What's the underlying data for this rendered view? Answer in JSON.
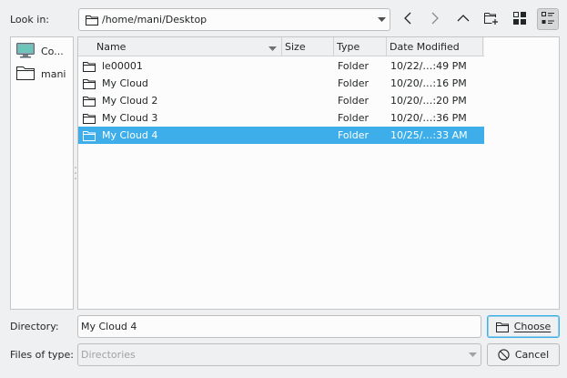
{
  "look_in": {
    "label": "Look in:",
    "path": "/home/mani/Desktop"
  },
  "toolbar": {
    "back": "chevron-left-icon",
    "forward": "chevron-right-icon",
    "up": "chevron-up-icon",
    "new_folder": "new-folder-icon",
    "icon_view": "icon-view-icon",
    "detail_view": "detail-view-icon"
  },
  "places": [
    {
      "label": "Co...",
      "icon": "computer-icon"
    },
    {
      "label": "mani",
      "icon": "folder-icon"
    }
  ],
  "columns": {
    "name": "Name",
    "size": "Size",
    "type": "Type",
    "date": "Date Modified"
  },
  "files": [
    {
      "name": "le00001",
      "size": "",
      "type": "Folder",
      "date": "10/22/…:49 PM"
    },
    {
      "name": "My Cloud",
      "size": "",
      "type": "Folder",
      "date": "10/20/…:16 PM"
    },
    {
      "name": "My Cloud 2",
      "size": "",
      "type": "Folder",
      "date": "10/20/…:20 PM"
    },
    {
      "name": "My Cloud 3",
      "size": "",
      "type": "Folder",
      "date": "10/20/…:36 PM"
    },
    {
      "name": "My Cloud 4",
      "size": "",
      "type": "Folder",
      "date": "10/25/…:33 AM"
    }
  ],
  "selected_index": 4,
  "directory": {
    "label": "Directory:",
    "value": "My Cloud 4"
  },
  "filetype": {
    "label": "Files of type:",
    "value": "Directories"
  },
  "buttons": {
    "choose": "Choose",
    "cancel": "Cancel"
  },
  "colors": {
    "selection": "#3daee9",
    "background": "#eff0f1",
    "view": "#fcfcfc"
  }
}
